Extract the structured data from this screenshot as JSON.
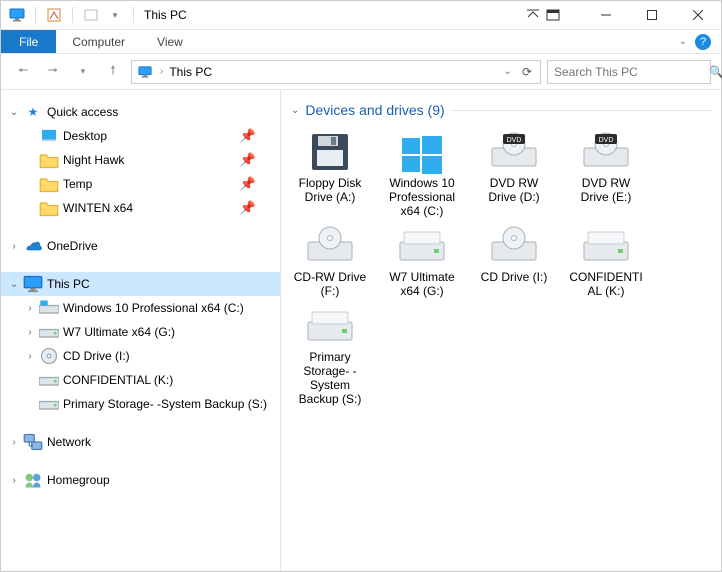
{
  "title": "This PC",
  "ribbon": {
    "file": "File",
    "computer": "Computer",
    "view": "View"
  },
  "address": {
    "location": "This PC",
    "search_placeholder": "Search This PC"
  },
  "nav": {
    "quick_access": "Quick access",
    "qa": {
      "desktop": "Desktop",
      "night_hawk": "Night Hawk",
      "temp": "Temp",
      "winten": "WINTEN x64"
    },
    "onedrive": "OneDrive",
    "this_pc": "This PC",
    "drives": {
      "c": "Windows 10 Professional x64 (C:)",
      "g": "W7 Ultimate x64 (G:)",
      "i": "CD Drive (I:)",
      "k": "CONFIDENTIAL (K:)",
      "s": "Primary Storage- -System Backup (S:)"
    },
    "network": "Network",
    "homegroup": "Homegroup"
  },
  "group": {
    "header": "Devices and drives (9)"
  },
  "tiles": {
    "a": "Floppy Disk Drive (A:)",
    "c": "Windows 10 Professional x64 (C:)",
    "d": "DVD RW Drive (D:)",
    "e": "DVD RW Drive (E:)",
    "f": "CD-RW Drive (F:)",
    "g": "W7 Ultimate x64 (G:)",
    "i": "CD Drive (I:)",
    "k": "CONFIDENTIAL (K:)",
    "s": "Primary Storage- -System Backup (S:)"
  }
}
